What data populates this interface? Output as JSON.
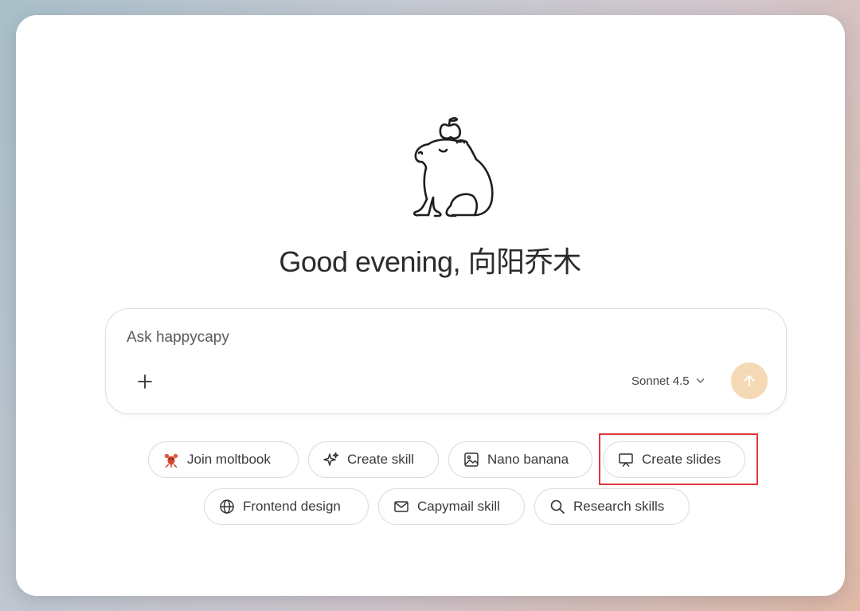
{
  "greeting": "Good evening, 向阳乔木",
  "composer": {
    "placeholder": "Ask happycapy",
    "model": "Sonnet 4.5"
  },
  "suggestions": [
    {
      "label": "Join moltbook",
      "icon": "lobster-emoji-icon"
    },
    {
      "label": "Create skill",
      "icon": "sparkles-icon"
    },
    {
      "label": "Nano banana",
      "icon": "image-icon"
    },
    {
      "label": "Create slides",
      "icon": "presentation-icon"
    },
    {
      "label": "Frontend design",
      "icon": "globe-icon"
    },
    {
      "label": "Capymail skill",
      "icon": "mail-icon"
    },
    {
      "label": "Research skills",
      "icon": "search-icon"
    }
  ],
  "colors": {
    "send_button": "#f5d9b4",
    "highlight": "#e0343a"
  }
}
